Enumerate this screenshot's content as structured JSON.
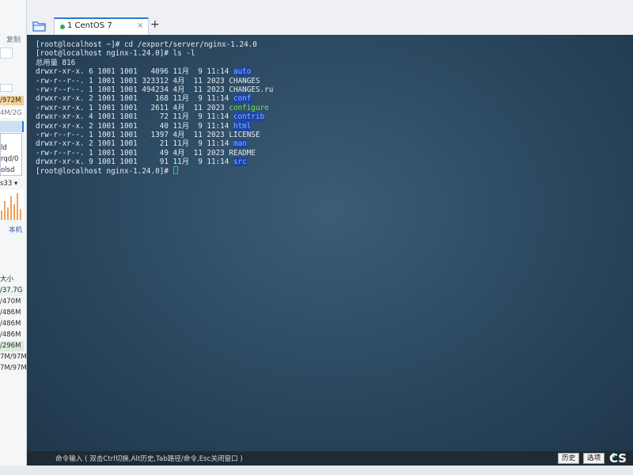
{
  "sidebar": {
    "copy_label": "复制",
    "mem_total": "/972M",
    "mem_second": "4M/2G",
    "procs": [
      "ld",
      "rqd/0",
      "olsd"
    ],
    "disk_selector": "s33",
    "local_label": "本机",
    "size_header": "大小",
    "disk_sizes": [
      "/37.7G",
      "/470M",
      "/486M",
      "/486M",
      "/486M",
      "/296M",
      "7M/97M",
      "7M/97M"
    ]
  },
  "tabs": [
    {
      "label": "1 CentOS 7",
      "close_glyph": "×",
      "active": true
    }
  ],
  "add_tab_glyph": "+",
  "terminal": {
    "lines": [
      {
        "pre": "[root@localhost ~]# cd /export/server/nginx-1.24.0",
        "name": "",
        "type": ""
      },
      {
        "pre": "[root@localhost nginx-1.24.0]# ls -l",
        "name": "",
        "type": ""
      },
      {
        "pre": "总用量 816",
        "name": "",
        "type": ""
      },
      {
        "pre": "drwxr-xr-x. 6 1001 1001   4096 11月  9 11:14 ",
        "name": "auto",
        "type": "dir"
      },
      {
        "pre": "-rw-r--r--. 1 1001 1001 323312 4月  11 2023 CHANGES",
        "name": "",
        "type": ""
      },
      {
        "pre": "-rw-r--r--. 1 1001 1001 494234 4月  11 2023 CHANGES.ru",
        "name": "",
        "type": ""
      },
      {
        "pre": "drwxr-xr-x. 2 1001 1001    168 11月  9 11:14 ",
        "name": "conf",
        "type": "dir"
      },
      {
        "pre": "-rwxr-xr-x. 1 1001 1001   2611 4月  11 2023 ",
        "name": "configure",
        "type": "exec"
      },
      {
        "pre": "drwxr-xr-x. 4 1001 1001     72 11月  9 11:14 ",
        "name": "contrib",
        "type": "dir"
      },
      {
        "pre": "drwxr-xr-x. 2 1001 1001     40 11月  9 11:14 ",
        "name": "html",
        "type": "dir"
      },
      {
        "pre": "-rw-r--r--. 1 1001 1001   1397 4月  11 2023 LICENSE",
        "name": "",
        "type": ""
      },
      {
        "pre": "drwxr-xr-x. 2 1001 1001     21 11月  9 11:14 ",
        "name": "man",
        "type": "dir"
      },
      {
        "pre": "-rw-r--r--. 1 1001 1001     49 4月  11 2023 README",
        "name": "",
        "type": ""
      },
      {
        "pre": "drwxr-xr-x. 9 1001 1001     91 11月  9 11:14 ",
        "name": "src",
        "type": "dir"
      },
      {
        "pre": "[root@localhost nginx-1.24.0]# ",
        "name": "",
        "type": "cursor"
      }
    ]
  },
  "command_bar": {
    "hint": "命令输入 ( 双击Ctrl切换,Alt历史,Tab路径/命令,Esc关闭窗口 )",
    "history_label": "历史",
    "options_label": "选项",
    "watermark": "CS"
  },
  "colors": {
    "accent": "#2a79d8",
    "dir_highlight": "#1e43a8",
    "exec_text": "#6fe46a",
    "terminal_bg": "#2d4b63"
  }
}
